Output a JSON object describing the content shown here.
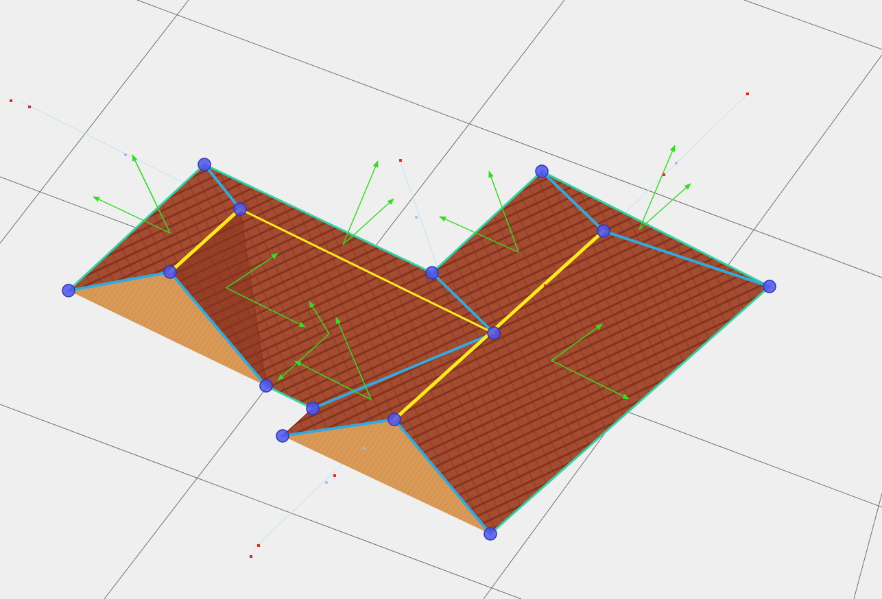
{
  "viewport": {
    "view": "3d-roof-editor",
    "background": "#efefef"
  },
  "colors": {
    "grid_line": "#6f6f6f",
    "roof_tile": "#a0482f",
    "roof_tile_dark": "#7b2a16",
    "gable_wood": "#d99a57",
    "ridge_highlight": "#ffea1e",
    "hip_line": "#33aadd",
    "eave_outline": "#2fd2a4",
    "normal_arrow": "#33dd22",
    "vertex_handle": "#4f55ee",
    "control_point": "#ee2222"
  },
  "icons": {
    "vertex_handle": "vertex-handle-icon",
    "normal_arrow": "face-normal-arrow-icon",
    "control_point": "control-point-icon"
  }
}
